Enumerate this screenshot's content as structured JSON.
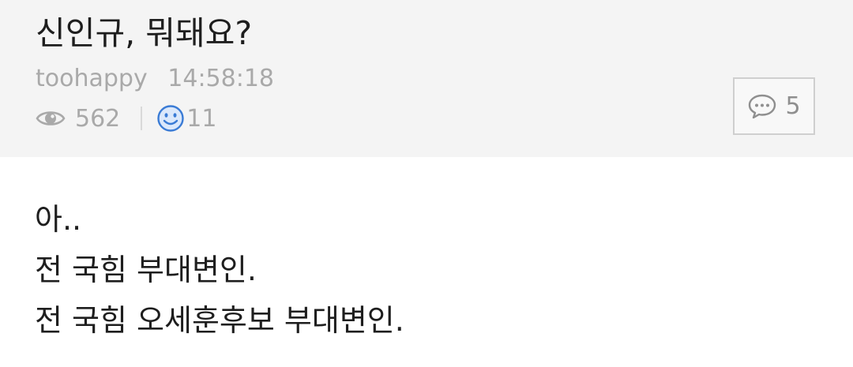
{
  "post": {
    "title": "신인규, 뭐돼요?",
    "author": "toohappy",
    "time": "14:58:18",
    "views": "562",
    "likes": "11",
    "comment_count": "5"
  },
  "content": {
    "lines": [
      "아..",
      "전 국힘 부대변인.",
      "전 국힘 오세훈후보 부대변인."
    ]
  },
  "icons": {
    "views": "eye-icon",
    "likes": "smiley-icon",
    "comments": "speech-bubble-icon"
  },
  "colors": {
    "header_bg": "#f4f4f4",
    "meta_text": "#a9a9a9",
    "title_text": "#1e1e1e",
    "smiley_blue": "#3a7bd5"
  }
}
